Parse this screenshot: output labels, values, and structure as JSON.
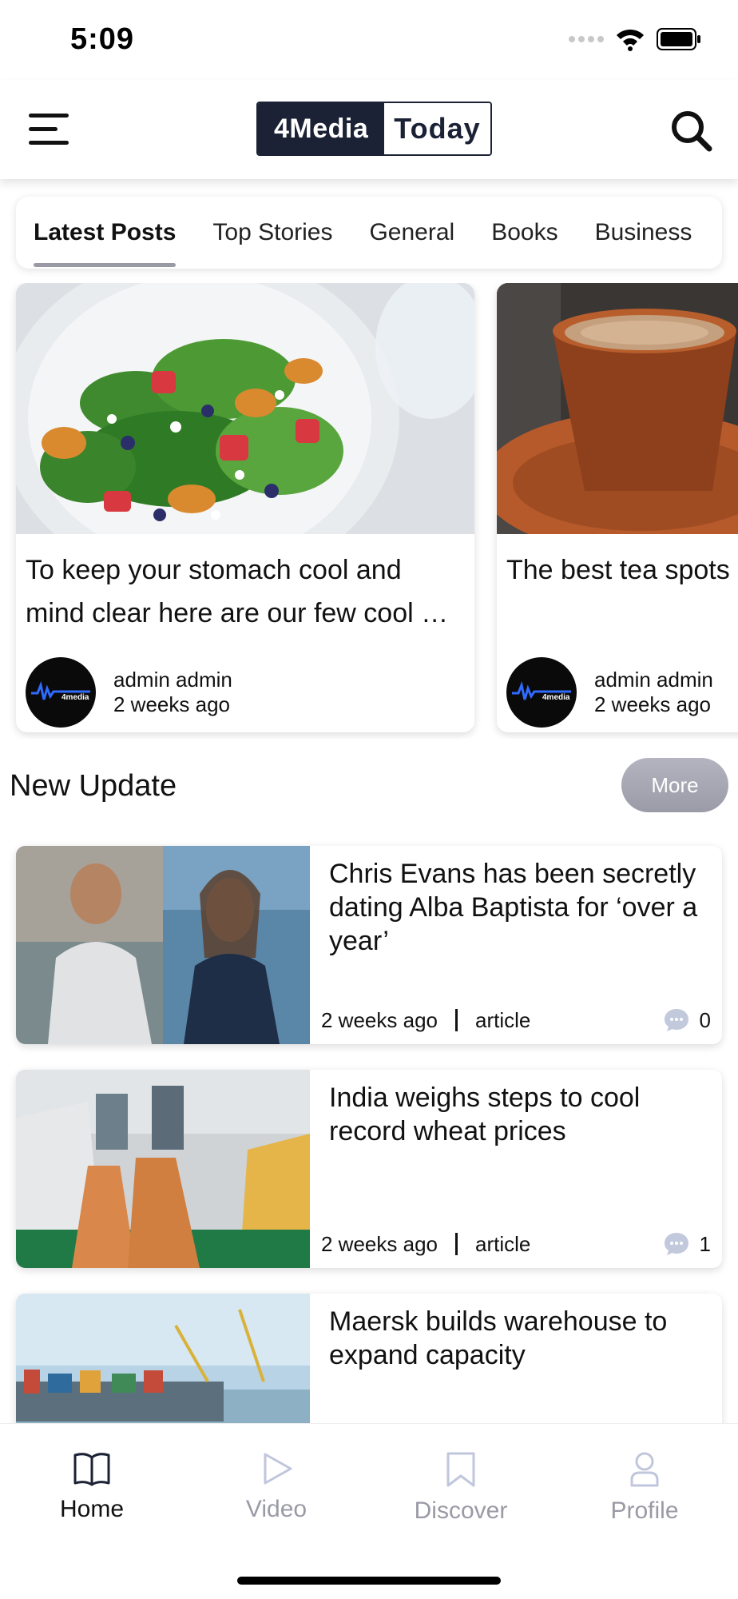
{
  "status_bar": {
    "time": "5:09"
  },
  "header": {
    "logo_left": "4Media",
    "logo_right": "Today"
  },
  "tabs": [
    {
      "label": "Latest Posts",
      "active": true
    },
    {
      "label": "Top Stories"
    },
    {
      "label": "General"
    },
    {
      "label": "Books"
    },
    {
      "label": "Business"
    }
  ],
  "latest_posts": [
    {
      "title": "To keep your stomach cool and mind clear here are our few cool …",
      "author": "admin admin",
      "time": "2 weeks ago",
      "avatar_text": "4media"
    },
    {
      "title": "The best tea spots",
      "author": "admin admin",
      "time": "2 weeks ago",
      "avatar_text": "4media"
    }
  ],
  "new_update": {
    "title": "New Update",
    "more_label": "More",
    "items": [
      {
        "title": "Chris Evans has been secretly dating Alba Baptista for ‘over a year’",
        "time": "2 weeks ago",
        "type": "article",
        "comments": "0"
      },
      {
        "title": "India weighs steps to cool record wheat prices",
        "time": "2 weeks ago",
        "type": "article",
        "comments": "1"
      },
      {
        "title": "Maersk builds warehouse to expand capacity",
        "time": "",
        "type": "",
        "comments": ""
      }
    ]
  },
  "bottom_nav": [
    {
      "label": "Home",
      "icon": "book-icon",
      "active": true
    },
    {
      "label": "Video",
      "icon": "play-icon"
    },
    {
      "label": "Discover",
      "icon": "bookmark-icon"
    },
    {
      "label": "Profile",
      "icon": "user-icon"
    }
  ],
  "colors": {
    "brand_dark": "#1c2236",
    "tab_indicator": "#9a9aa6",
    "inactive_nav": "#9a9aa6",
    "comment_icon": "#c3c9dc"
  }
}
